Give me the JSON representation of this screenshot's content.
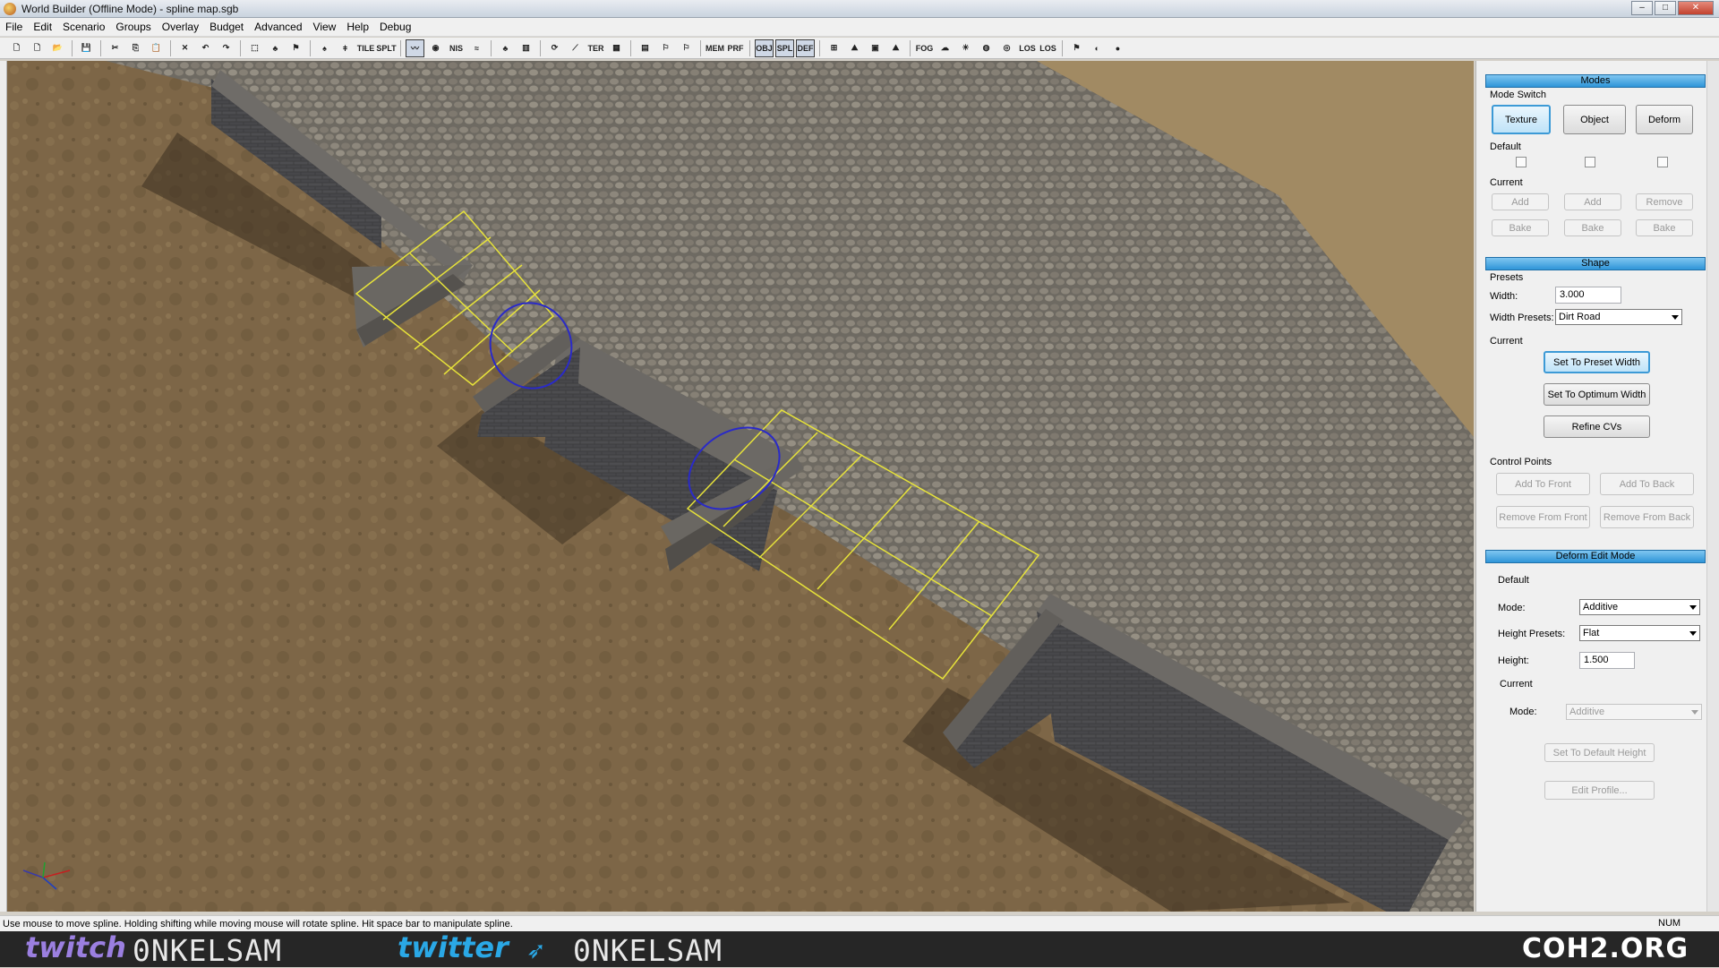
{
  "window": {
    "title": "World Builder (Offline Mode) - spline map.sgb",
    "min": "–",
    "max": "□",
    "close": "✕"
  },
  "menu": [
    "File",
    "Edit",
    "Scenario",
    "Groups",
    "Overlay",
    "Budget",
    "Advanced",
    "View",
    "Help",
    "Debug"
  ],
  "toolbar": {
    "icons": [
      "new-icon",
      "new-alt-icon",
      "open-icon",
      "sep",
      "save-icon",
      "sep",
      "cut-icon",
      "copy-icon",
      "paste-icon",
      "sep",
      "delete-icon",
      "undo-icon",
      "redo-icon",
      "sep",
      "select-icon",
      "tree-icon",
      "flag-icon",
      "sep",
      "bush-icon",
      "lamp-icon",
      "TILE",
      "SPLT",
      "sep",
      "spline-icon",
      "water-icon",
      "NIS",
      "wind-icon",
      "sep",
      "tree2-icon",
      "chart-icon",
      "sep",
      "snap-icon",
      "ruler-icon",
      "TER",
      "grid-icon",
      "sep",
      "map-icon",
      "marker-icon",
      "marker2-icon",
      "sep",
      "MEM",
      "PRF",
      "sep",
      "OBJ",
      "SPL",
      "DEF",
      "sep",
      "zone-icon",
      "terrain-icon",
      "terrain2-icon",
      "terrain3-icon",
      "sep",
      "FOG",
      "sky-icon",
      "sun-icon",
      "globe-icon",
      "cam-icon",
      "LOS",
      "LOS",
      "sep",
      "flag2-icon",
      "ai-icon",
      "rec-icon"
    ],
    "active": [
      "spline-icon",
      "OBJ",
      "SPL",
      "DEF"
    ]
  },
  "panel": {
    "modes_header": "Modes",
    "mode_switch_label": "Mode Switch",
    "mode_buttons": [
      "Texture",
      "Object",
      "Deform"
    ],
    "default_label": "Default",
    "current_label": "Current",
    "current_row1": [
      "Add",
      "Add",
      "Remove"
    ],
    "current_row2": [
      "Bake",
      "Bake",
      "Bake"
    ],
    "shape_header": "Shape",
    "presets_label": "Presets",
    "width_label": "Width:",
    "width_value": "3.000",
    "width_presets_label": "Width Presets:",
    "width_presets_value": "Dirt Road",
    "shape_current_label": "Current",
    "set_preset_width": "Set To Preset Width",
    "set_optimum_width": "Set To Optimum Width",
    "refine_cvs": "Refine CVs",
    "control_points_label": "Control Points",
    "add_to_front": "Add To Front",
    "add_to_back": "Add To Back",
    "remove_from_front": "Remove From Front",
    "remove_from_back": "Remove From Back",
    "deform_header": "Deform Edit Mode",
    "deform_default_label": "Default",
    "mode_label": "Mode:",
    "mode_value": "Additive",
    "height_presets_label": "Height Presets:",
    "height_presets_value": "Flat",
    "height_label": "Height:",
    "height_value": "1.500",
    "deform_current_label": "Current",
    "current_mode_label": "Mode:",
    "current_mode_value": "Additive",
    "set_default_height": "Set To Default Height",
    "edit_profile": "Edit Profile..."
  },
  "status": {
    "text": "Use mouse to move spline. Holding shifting while moving mouse will rotate spline. Hit space bar to manipulate spline.",
    "num": "NUM"
  },
  "stream": {
    "twitch": "twitch",
    "twitch_handle": "0NKELSAM",
    "twitter": "twitter",
    "twitter_handle": "0NKELSAM",
    "site": "COH2.ORG"
  },
  "colors": {
    "accent": "#2f95d8",
    "spline": "#e6e23a",
    "circle": "#2a2ac8",
    "twitch": "#9b7fe0",
    "twitter": "#2aa8e6"
  }
}
